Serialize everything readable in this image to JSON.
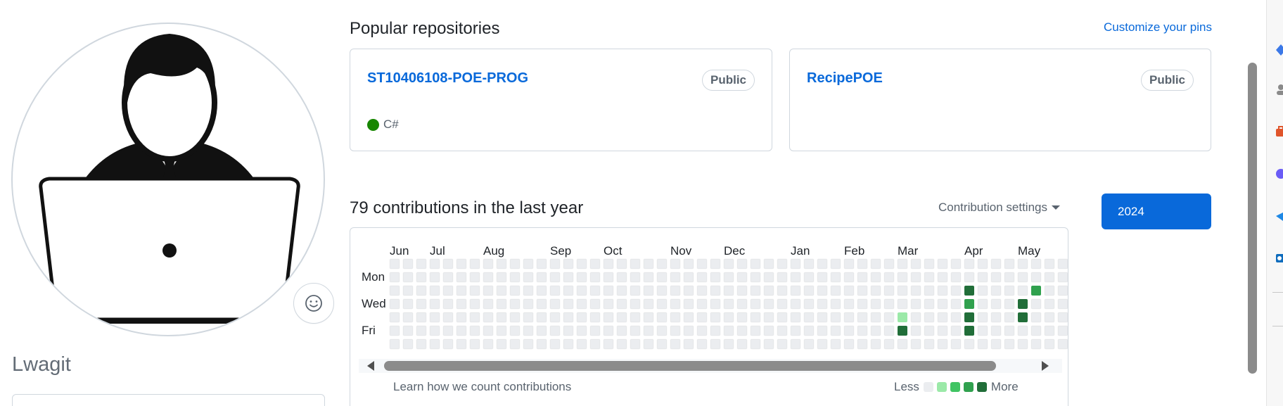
{
  "profile": {
    "username": "Lwagit",
    "avatar_icon": "man-with-laptop-avatar",
    "status_icon": "smiley-icon"
  },
  "pinned": {
    "title": "Popular repositories",
    "customize_label": "Customize your pins",
    "repos": [
      {
        "name": "ST10406108-POE-PROG",
        "visibility": "Public",
        "language": "C#",
        "language_color": "#178600"
      },
      {
        "name": "RecipePOE",
        "visibility": "Public",
        "language": "",
        "language_color": ""
      }
    ]
  },
  "contributions": {
    "title": "79 contributions in the last year",
    "settings_label": "Contribution settings",
    "year_button": "2024",
    "months": [
      "Jun",
      "Jul",
      "Aug",
      "Sep",
      "Oct",
      "Nov",
      "Dec",
      "Jan",
      "Feb",
      "Mar",
      "Apr",
      "May"
    ],
    "day_labels": [
      "Mon",
      "Wed",
      "Fri"
    ],
    "learn_link": "Learn how we count contributions",
    "legend_less": "Less",
    "legend_more": "More",
    "level_colors": [
      "#ebedf0",
      "#9be9a8",
      "#40c463",
      "#30a14e",
      "#216e39"
    ],
    "active_cells": [
      {
        "week": 38,
        "day": 4,
        "level": 1
      },
      {
        "week": 38,
        "day": 5,
        "level": 4
      },
      {
        "week": 43,
        "day": 2,
        "level": 4
      },
      {
        "week": 43,
        "day": 3,
        "level": 3
      },
      {
        "week": 43,
        "day": 4,
        "level": 4
      },
      {
        "week": 43,
        "day": 5,
        "level": 4
      },
      {
        "week": 47,
        "day": 3,
        "level": 4
      },
      {
        "week": 47,
        "day": 4,
        "level": 4
      },
      {
        "week": 48,
        "day": 2,
        "level": 3
      }
    ]
  },
  "colors": {
    "link": "#0969da",
    "primary_button": "#0969da",
    "border": "#d0d7de",
    "muted_text": "#59636e"
  }
}
